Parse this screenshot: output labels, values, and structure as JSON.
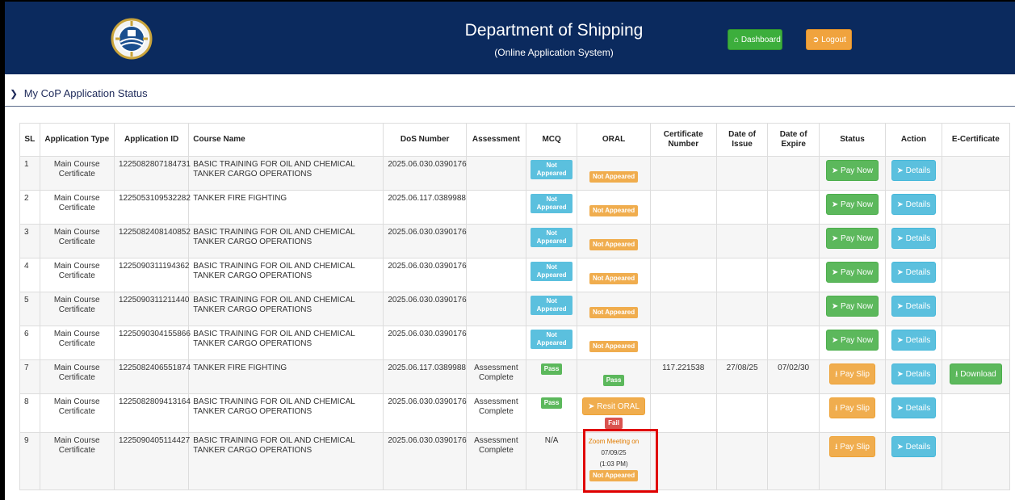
{
  "header": {
    "title": "Department of Shipping",
    "subtitle": "(Online Application System)",
    "dashboard_label": "Dashboard",
    "logout_label": "Logout"
  },
  "section": {
    "title": "My CoP Application Status"
  },
  "table": {
    "columns": [
      "SL",
      "Application Type",
      "Application ID",
      "Course Name",
      "DoS Number",
      "Assessment",
      "MCQ",
      "ORAL",
      "Certificate Number",
      "Date of Issue",
      "Date of Expire",
      "Status",
      "Action",
      "E-Certificate"
    ],
    "rows": [
      {
        "sl": "1",
        "type": "Main Course Certificate",
        "app_id": "1225082807184731",
        "course": "BASIC TRAINING FOR OIL AND CHEMICAL TANKER CARGO OPERATIONS",
        "dos": "2025.06.030.0390176",
        "assessment": "",
        "mcq": "Not Appeared",
        "oral": "Not Appeared",
        "cert_no": "",
        "issue": "",
        "expire": "",
        "status": "Pay Now",
        "action": "Details",
        "ecert": ""
      },
      {
        "sl": "2",
        "type": "Main Course Certificate",
        "app_id": "1225053109532282",
        "course": "TANKER FIRE FIGHTING",
        "dos": "2025.06.117.0389988",
        "assessment": "",
        "mcq": "Not Appeared",
        "oral": "Not Appeared",
        "cert_no": "",
        "issue": "",
        "expire": "",
        "status": "Pay Now",
        "action": "Details",
        "ecert": ""
      },
      {
        "sl": "3",
        "type": "Main Course Certificate",
        "app_id": "1225082408140852",
        "course": "BASIC TRAINING FOR OIL AND CHEMICAL TANKER CARGO OPERATIONS",
        "dos": "2025.06.030.0390176",
        "assessment": "",
        "mcq": "Not Appeared",
        "oral": "Not Appeared",
        "cert_no": "",
        "issue": "",
        "expire": "",
        "status": "Pay Now",
        "action": "Details",
        "ecert": ""
      },
      {
        "sl": "4",
        "type": "Main Course Certificate",
        "app_id": "1225090311194362",
        "course": "BASIC TRAINING FOR OIL AND CHEMICAL TANKER CARGO OPERATIONS",
        "dos": "2025.06.030.0390176",
        "assessment": "",
        "mcq": "Not Appeared",
        "oral": "Not Appeared",
        "cert_no": "",
        "issue": "",
        "expire": "",
        "status": "Pay Now",
        "action": "Details",
        "ecert": ""
      },
      {
        "sl": "5",
        "type": "Main Course Certificate",
        "app_id": "1225090311211440",
        "course": "BASIC TRAINING FOR OIL AND CHEMICAL TANKER CARGO OPERATIONS",
        "dos": "2025.06.030.0390176",
        "assessment": "",
        "mcq": "Not Appeared",
        "oral": "Not Appeared",
        "cert_no": "",
        "issue": "",
        "expire": "",
        "status": "Pay Now",
        "action": "Details",
        "ecert": ""
      },
      {
        "sl": "6",
        "type": "Main Course Certificate",
        "app_id": "1225090304155866",
        "course": "BASIC TRAINING FOR OIL AND CHEMICAL TANKER CARGO OPERATIONS",
        "dos": "2025.06.030.0390176",
        "assessment": "",
        "mcq": "Not Appeared",
        "oral": "Not Appeared",
        "cert_no": "",
        "issue": "",
        "expire": "",
        "status": "Pay Now",
        "action": "Details",
        "ecert": ""
      },
      {
        "sl": "7",
        "type": "Main Course Certificate",
        "app_id": "1225082406551874",
        "course": "TANKER FIRE FIGHTING",
        "dos": "2025.06.117.0389988",
        "assessment": "Assessment Complete",
        "mcq": "Pass",
        "oral": "Pass",
        "cert_no": "117.221538",
        "issue": "27/08/25",
        "expire": "07/02/30",
        "status": "Pay Slip",
        "action": "Details",
        "ecert": "Download"
      },
      {
        "sl": "8",
        "type": "Main Course Certificate",
        "app_id": "1225082809413164",
        "course": "BASIC TRAINING FOR OIL AND CHEMICAL TANKER CARGO OPERATIONS",
        "dos": "2025.06.030.0390176",
        "assessment": "Assessment Complete",
        "mcq": "Pass",
        "oral_button": "Resit ORAL",
        "oral": "Fail",
        "cert_no": "",
        "issue": "",
        "expire": "",
        "status": "Pay Slip",
        "action": "Details",
        "ecert": ""
      },
      {
        "sl": "9",
        "type": "Main Course Certificate",
        "app_id": "1225090405114427",
        "course": "BASIC TRAINING FOR OIL AND CHEMICAL TANKER CARGO OPERATIONS",
        "dos": "2025.06.030.0390176",
        "assessment": "Assessment Complete",
        "mcq": "N/A",
        "oral_zoom": "Zoom Meeting on",
        "oral_date": "07/09/25",
        "oral_time": "(1:03 PM)",
        "oral": "Not Appeared",
        "cert_no": "",
        "issue": "",
        "expire": "",
        "status": "Pay Slip",
        "action": "Details",
        "ecert": ""
      }
    ]
  },
  "icons": {
    "dashboard": "home-icon",
    "logout": "sign-out-icon",
    "pay_now": "arrow-circle-right-icon",
    "details": "arrow-circle-right-icon",
    "pay_slip": "download-icon",
    "download": "download-icon",
    "section": "chevron-down-icon"
  },
  "colors": {
    "header_bg": "#0b2a5e",
    "green": "#5cb85c",
    "blue": "#5bc0de",
    "orange": "#f0ad4e",
    "red": "#d9534f",
    "highlight": "#e00000"
  }
}
